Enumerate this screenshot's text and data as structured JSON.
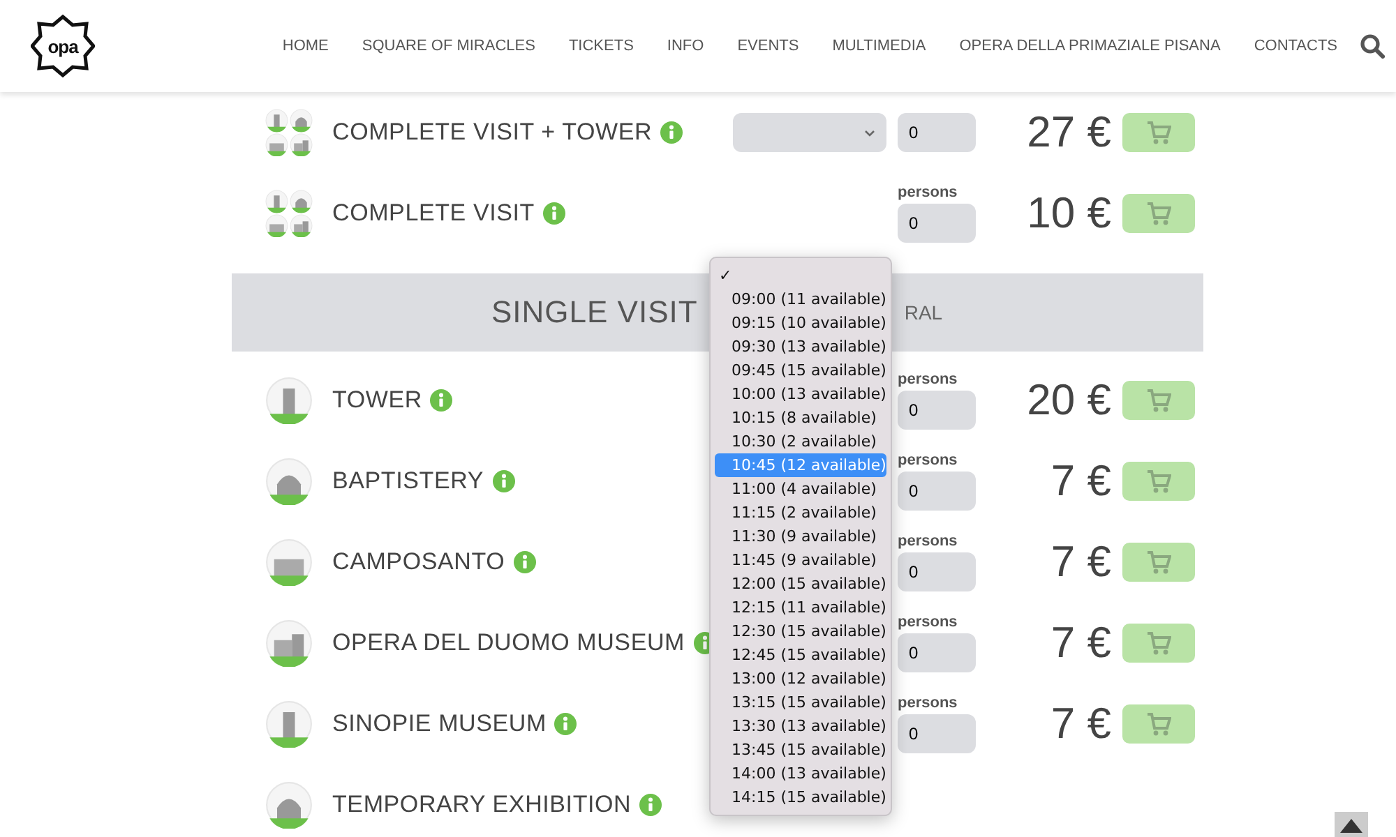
{
  "header": {
    "logo_text": "opa",
    "nav": [
      {
        "label": "HOME"
      },
      {
        "label": "SQUARE OF MIRACLES"
      },
      {
        "label": "TICKETS"
      },
      {
        "label": "INFO"
      },
      {
        "label": "EVENTS"
      },
      {
        "label": "MULTIMEDIA"
      },
      {
        "label": "OPERA DELLA PRIMAZIALE PISANA"
      },
      {
        "label": "CONTACTS"
      }
    ]
  },
  "combo_rows": [
    {
      "kind": "combo",
      "name": "COMPLETE VISIT + TOWER",
      "time_select": true,
      "quantity": "0",
      "price": "27 €"
    },
    {
      "kind": "combo",
      "name": "COMPLETE VISIT",
      "persons_label": "persons",
      "quantity": "0",
      "price": "10 €"
    }
  ],
  "section": {
    "title": "SINGLE VISIT",
    "title_tail": "RAL"
  },
  "single_rows": [
    {
      "kind": "single",
      "name": "TOWER",
      "persons_label": "persons",
      "quantity": "0",
      "price": "20 €"
    },
    {
      "kind": "single",
      "name": "BAPTISTERY",
      "persons_label": "persons",
      "quantity": "0",
      "price": "7 €"
    },
    {
      "kind": "single",
      "name": "CAMPOSANTO",
      "persons_label": "persons",
      "quantity": "0",
      "price": "7 €"
    },
    {
      "kind": "single",
      "name": "OPERA DEL DUOMO MUSEUM",
      "persons_label": "persons",
      "quantity": "0",
      "price": "7 €"
    },
    {
      "kind": "single",
      "name": "SINOPIE MUSEUM",
      "persons_label": "persons",
      "quantity": "0",
      "price": "7 €"
    },
    {
      "kind": "single",
      "name": "TEMPORARY EXHIBITION"
    }
  ],
  "time_dropdown": {
    "check_mark": "✓",
    "options": [
      {
        "label": "09:00 (11 available)",
        "selected": false
      },
      {
        "label": "09:15 (10 available)",
        "selected": false
      },
      {
        "label": "09:30 (13 available)",
        "selected": false
      },
      {
        "label": "09:45 (15 available)",
        "selected": false
      },
      {
        "label": "10:00 (13 available)",
        "selected": false
      },
      {
        "label": "10:15 (8 available)",
        "selected": false
      },
      {
        "label": "10:30 (2 available)",
        "selected": false
      },
      {
        "label": "10:45 (12 available)",
        "selected": true
      },
      {
        "label": "11:00 (4 available)",
        "selected": false
      },
      {
        "label": "11:15 (2 available)",
        "selected": false
      },
      {
        "label": "11:30 (9 available)",
        "selected": false
      },
      {
        "label": "11:45 (9 available)",
        "selected": false
      },
      {
        "label": "12:00 (15 available)",
        "selected": false
      },
      {
        "label": "12:15 (11 available)",
        "selected": false
      },
      {
        "label": "12:30 (15 available)",
        "selected": false
      },
      {
        "label": "12:45 (15 available)",
        "selected": false
      },
      {
        "label": "13:00 (12 available)",
        "selected": false
      },
      {
        "label": "13:15 (15 available)",
        "selected": false
      },
      {
        "label": "13:30 (13 available)",
        "selected": false
      },
      {
        "label": "13:45 (15 available)",
        "selected": false
      },
      {
        "label": "14:00 (13 available)",
        "selected": false
      },
      {
        "label": "14:15 (15 available)",
        "selected": false
      }
    ]
  }
}
